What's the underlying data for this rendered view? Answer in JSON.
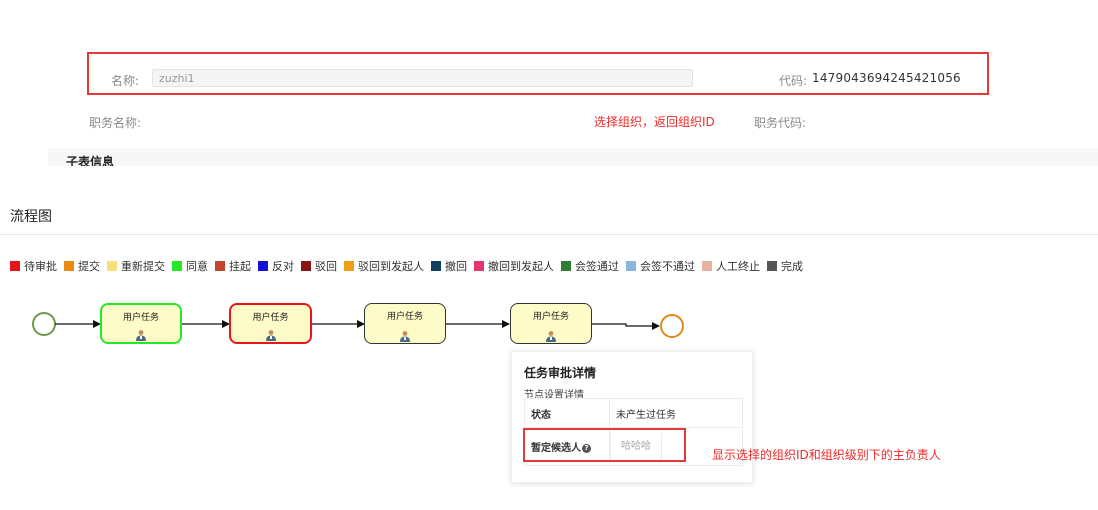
{
  "form": {
    "name_label": "名称:",
    "name_value": "zuzhi1",
    "code_label": "代码:",
    "code_value": "1479043694245421056",
    "position_name_label": "职务名称:",
    "position_code_label": "职务代码:",
    "annotation_org": "选择组织，返回组织ID"
  },
  "subtable": {
    "title": "子表信息"
  },
  "flow": {
    "title": "流程图",
    "legend": [
      {
        "label": "待审批",
        "color": "#e8161b"
      },
      {
        "label": "提交",
        "color": "#e88a13"
      },
      {
        "label": "重新提交",
        "color": "#f8dd7f"
      },
      {
        "label": "同意",
        "color": "#27e827"
      },
      {
        "label": "挂起",
        "color": "#c0462c"
      },
      {
        "label": "反对",
        "color": "#1111d8"
      },
      {
        "label": "驳回",
        "color": "#8b1414"
      },
      {
        "label": "驳回到发起人",
        "color": "#ef9f15"
      },
      {
        "label": "撤回",
        "color": "#123e5e"
      },
      {
        "label": "撤回到发起人",
        "color": "#e4366a"
      },
      {
        "label": "会签通过",
        "color": "#2e7d32"
      },
      {
        "label": "会签不通过",
        "color": "#8bb5de"
      },
      {
        "label": "人工终止",
        "color": "#e5b4a0"
      },
      {
        "label": "完成",
        "color": "#555555"
      }
    ],
    "tasks": [
      {
        "label": "用户任务",
        "status_color": "#27e827"
      },
      {
        "label": "用户任务",
        "status_color": "#e8161b"
      },
      {
        "label": "用户任务",
        "status_color": "#333333"
      },
      {
        "label": "用户任务",
        "status_color": "#333333"
      }
    ],
    "start_event_color": "#6a9a4a",
    "end_event_color": "#e08a1e"
  },
  "popup": {
    "title": "任务审批详情",
    "subtitle": "节点设置详情",
    "status_label": "状态",
    "status_value": "未产生过任务",
    "candidate_label": "暂定候选人",
    "candidate_value": "哈哈哈",
    "help_icon": "?"
  },
  "annotation_candidate": "显示选择的组织ID和组织级别下的主负责人"
}
